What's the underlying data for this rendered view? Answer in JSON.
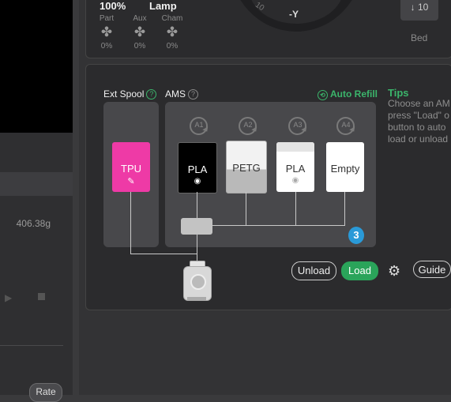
{
  "left": {
    "weight": "406.38g",
    "rate_label": "Rate"
  },
  "top": {
    "speed_value": "100%",
    "lamp_label": "Lamp",
    "fans": [
      {
        "label": "Part",
        "value": "0%"
      },
      {
        "label": "Aux",
        "value": "0%"
      },
      {
        "label": "Cham",
        "value": "0%"
      }
    ],
    "joystick_y": "-Y",
    "joystick_step": "10",
    "bed_step": "10",
    "bed_label": "Bed"
  },
  "ams": {
    "ext_spool_label": "Ext Spool",
    "ams_label": "AMS",
    "help_glyph": "?",
    "auto_refill_label": "Auto Refill",
    "ext_tray": {
      "name": "TPU",
      "color": "#ee3aa6"
    },
    "slots": [
      {
        "id": "A1",
        "name": "PLA",
        "color": "#000000"
      },
      {
        "id": "A2",
        "name": "PETG",
        "color": "#f2f2f2"
      },
      {
        "id": "A3",
        "name": "PLA",
        "color": "#ffffff"
      },
      {
        "id": "A4",
        "name": "Empty",
        "color": "#ffffff"
      }
    ],
    "count_badge": "3",
    "unload_label": "Unload",
    "load_label": "Load",
    "guide_label": "Guide"
  },
  "tips": {
    "title": "Tips",
    "text": "Choose an AM\npress \"Load\" o\nbutton to auto\nload or unload"
  },
  "colors": {
    "accent": "#2aa45a",
    "badge": "#2a9ad8"
  }
}
